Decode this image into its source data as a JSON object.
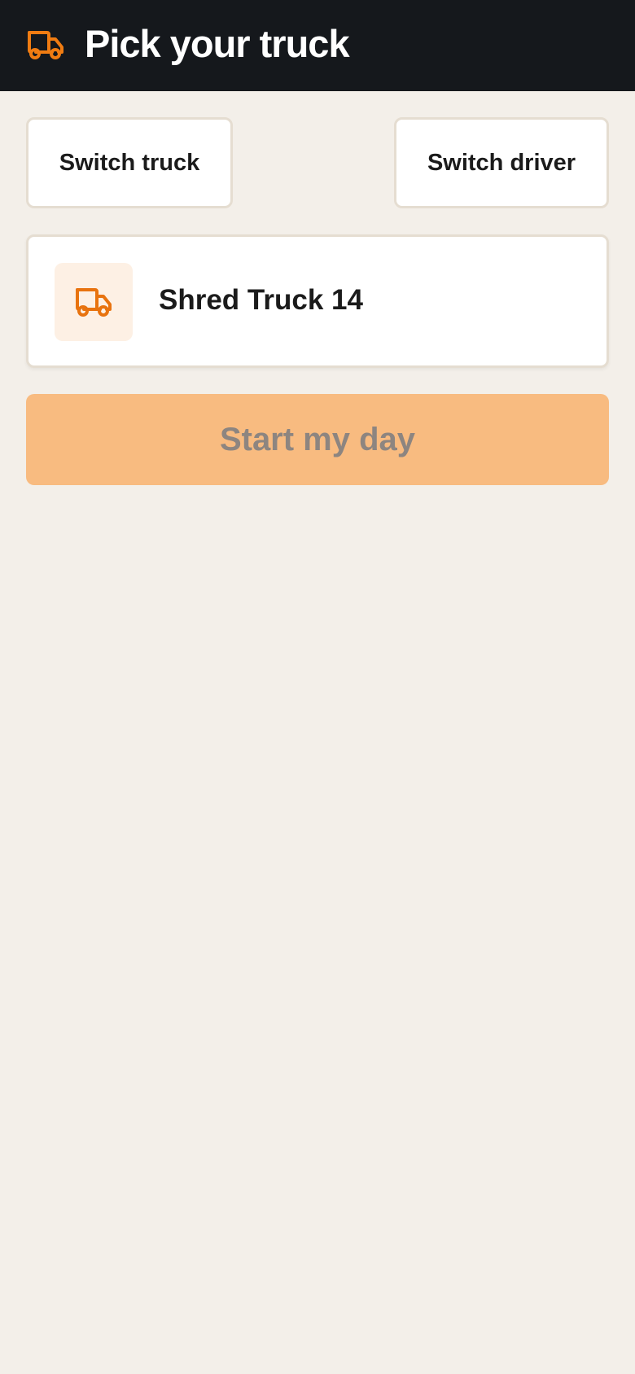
{
  "header": {
    "title": "Pick your truck",
    "icon": "truck-icon",
    "background": "#15181c",
    "accent": "#f07c12"
  },
  "actions": {
    "switch_truck_label": "Switch truck",
    "switch_driver_label": "Switch driver"
  },
  "selected_truck": {
    "name": "Shred Truck 14",
    "icon": "truck-icon"
  },
  "primary": {
    "start_label": "Start my day",
    "color": "#f8bb80",
    "state": "disabled"
  }
}
